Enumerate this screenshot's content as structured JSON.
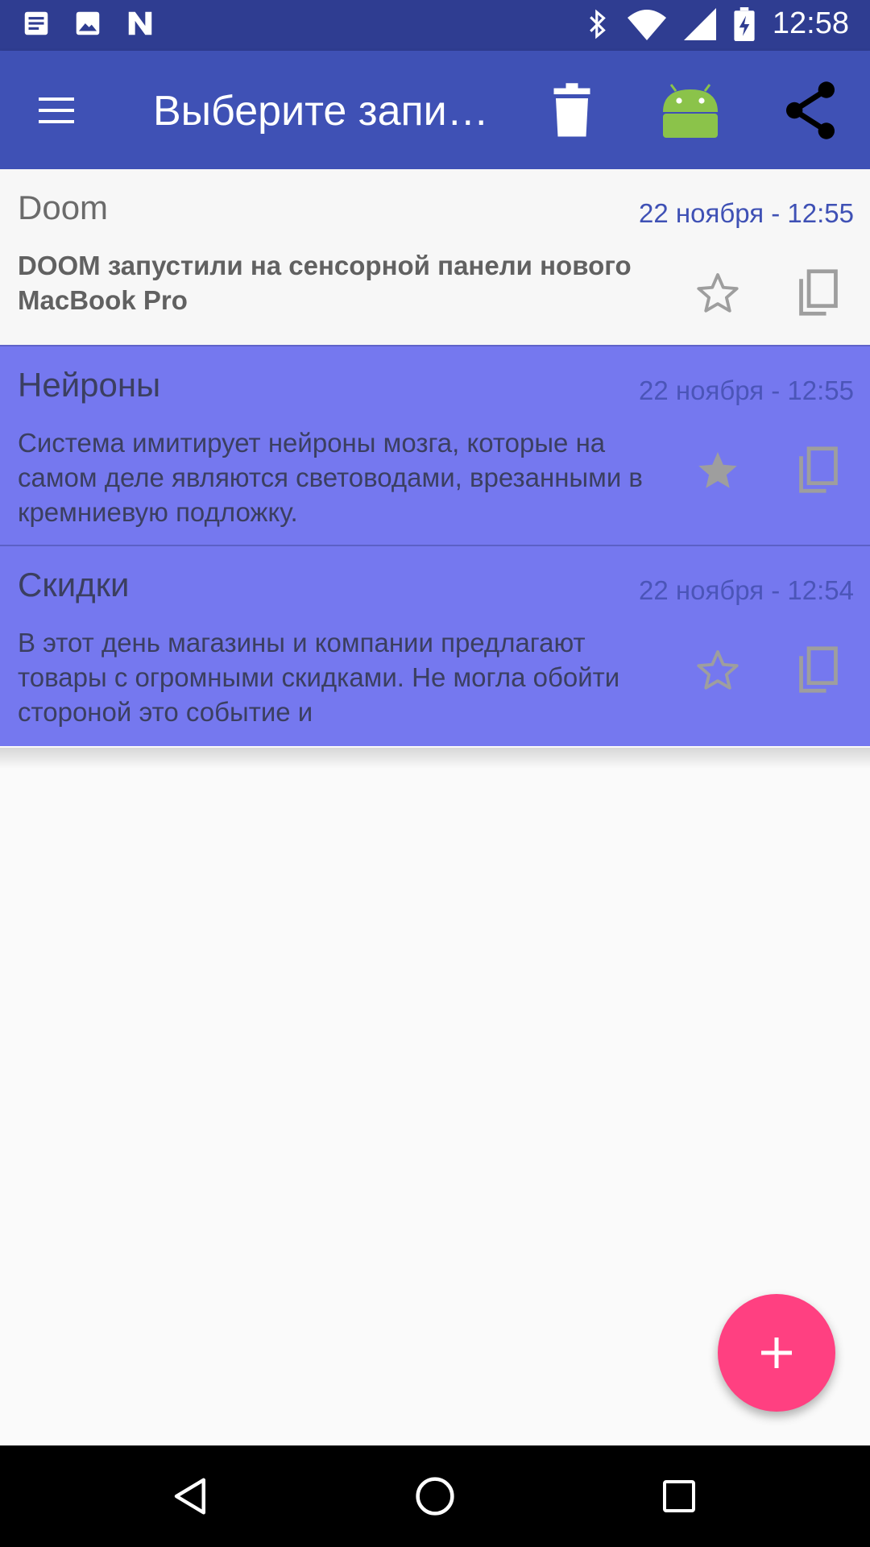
{
  "status_bar": {
    "time": "12:58",
    "left_icons": [
      "notes-icon",
      "image-icon",
      "n-icon"
    ],
    "right_icons": [
      "bluetooth-icon",
      "wifi-icon",
      "signal-icon",
      "battery-icon"
    ]
  },
  "toolbar": {
    "title": "Выберите запи…",
    "actions": [
      "delete-icon",
      "android-icon",
      "share-icon"
    ],
    "colors": {
      "background": "#3f51b5",
      "status_bar": "#2f3d91"
    }
  },
  "notes": [
    {
      "title": "Doom",
      "date": "22 ноября - 12:55",
      "text": "DOOM запустили на сенсорной панели нового MacBook Pro",
      "starred": false,
      "selected": false
    },
    {
      "title": "Нейроны",
      "date": "22 ноября - 12:55",
      "text": "Система имитирует нейроны мозга, которые на самом деле являются световодами, врезанными в кремниевую подложку.",
      "starred": true,
      "selected": true
    },
    {
      "title": "Скидки",
      "date": "22 ноября - 12:54",
      "text": "В этот день магазины и компании предлагают товары с огромными скидками. Не могла обойти стороной это событие и",
      "starred": false,
      "selected": true
    }
  ],
  "fab": {
    "icon": "plus-icon",
    "color": "#ff4081"
  },
  "selection_color": "#7578ef",
  "nav_bar": {
    "icons": [
      "back-icon",
      "home-icon",
      "recents-icon"
    ]
  }
}
